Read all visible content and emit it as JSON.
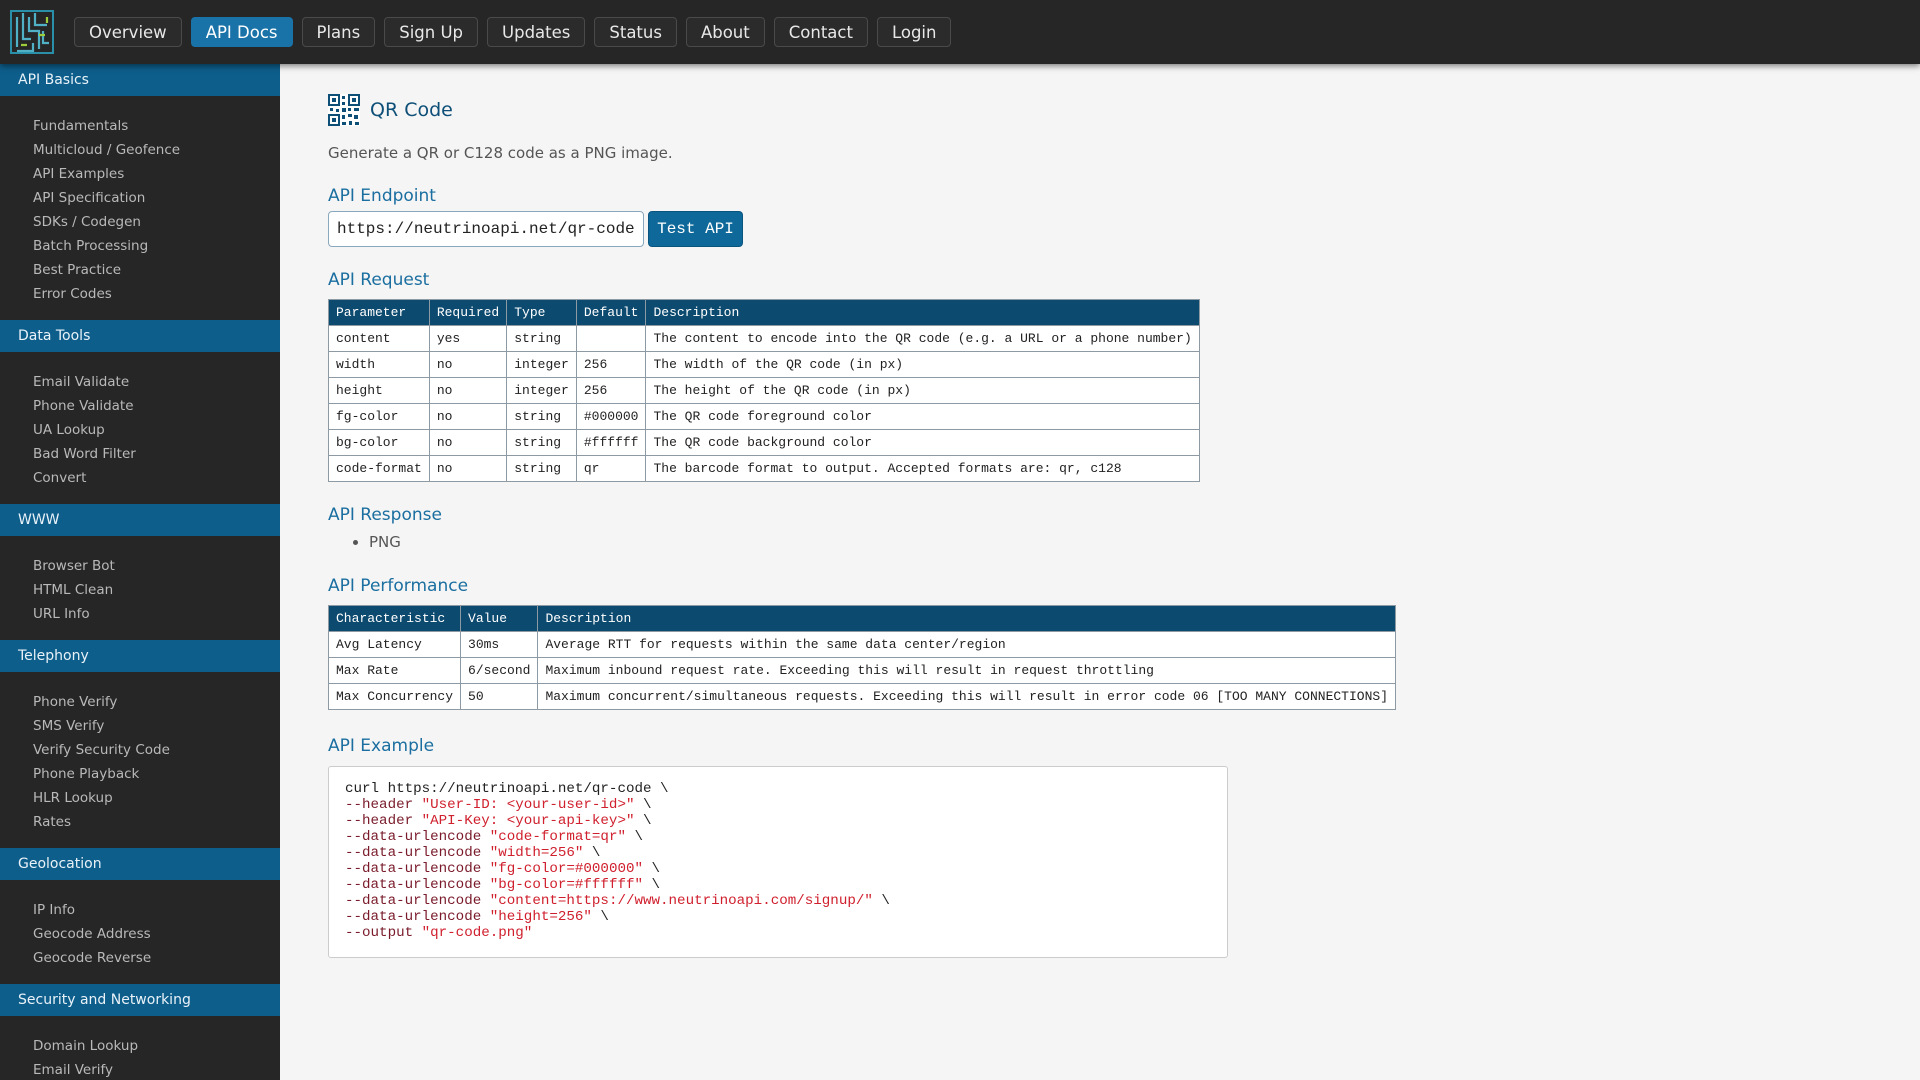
{
  "topnav": {
    "logo": "neutrino-logo-icon",
    "items": [
      {
        "label": "Overview",
        "active": false
      },
      {
        "label": "API Docs",
        "active": true
      },
      {
        "label": "Plans",
        "active": false
      },
      {
        "label": "Sign Up",
        "active": false
      },
      {
        "label": "Updates",
        "active": false
      },
      {
        "label": "Status",
        "active": false
      },
      {
        "label": "About",
        "active": false
      },
      {
        "label": "Contact",
        "active": false
      },
      {
        "label": "Login",
        "active": false
      }
    ]
  },
  "sidebar": {
    "sections": [
      {
        "title": "API Basics",
        "items": [
          "Fundamentals",
          "Multicloud / Geofence",
          "API Examples",
          "API Specification",
          "SDKs / Codegen",
          "Batch Processing",
          "Best Practice",
          "Error Codes"
        ]
      },
      {
        "title": "Data Tools",
        "items": [
          "Email Validate",
          "Phone Validate",
          "UA Lookup",
          "Bad Word Filter",
          "Convert"
        ]
      },
      {
        "title": "WWW",
        "items": [
          "Browser Bot",
          "HTML Clean",
          "URL Info"
        ]
      },
      {
        "title": "Telephony",
        "items": [
          "Phone Verify",
          "SMS Verify",
          "Verify Security Code",
          "Phone Playback",
          "HLR Lookup",
          "Rates"
        ]
      },
      {
        "title": "Geolocation",
        "items": [
          "IP Info",
          "Geocode Address",
          "Geocode Reverse"
        ]
      },
      {
        "title": "Security and Networking",
        "items": [
          "Domain Lookup",
          "Email Verify"
        ]
      }
    ]
  },
  "main": {
    "title": "QR Code",
    "title_icon": "qr-code-icon",
    "description": "Generate a QR or C128 code as a PNG image.",
    "endpoint": {
      "heading": "API Endpoint",
      "url": "https://neutrinoapi.net/qr-code",
      "button": "Test API"
    },
    "request": {
      "heading": "API Request",
      "headers": [
        "Parameter",
        "Required",
        "Type",
        "Default",
        "Description"
      ],
      "rows": [
        [
          "content",
          "yes",
          "string",
          "",
          "The content to encode into the QR code (e.g. a URL or a phone number)"
        ],
        [
          "width",
          "no",
          "integer",
          "256",
          "The width of the QR code (in px)"
        ],
        [
          "height",
          "no",
          "integer",
          "256",
          "The height of the QR code (in px)"
        ],
        [
          "fg-color",
          "no",
          "string",
          "#000000",
          "The QR code foreground color"
        ],
        [
          "bg-color",
          "no",
          "string",
          "#ffffff",
          "The QR code background color"
        ],
        [
          "code-format",
          "no",
          "string",
          "qr",
          "The barcode format to output. Accepted formats are: qr, c128"
        ]
      ]
    },
    "response": {
      "heading": "API Response",
      "items": [
        "PNG"
      ]
    },
    "performance": {
      "heading": "API Performance",
      "headers": [
        "Characteristic",
        "Value",
        "Description"
      ],
      "rows": [
        [
          "Avg Latency",
          "30ms",
          "Average RTT for requests within the same data center/region"
        ],
        [
          "Max Rate",
          "6/second",
          "Maximum inbound request rate. Exceeding this will result in request throttling"
        ],
        [
          "Max Concurrency",
          "50",
          "Maximum concurrent/simultaneous requests. Exceeding this will result in error code 06 [TOO MANY CONNECTIONS]"
        ]
      ]
    },
    "example": {
      "heading": "API Example",
      "lines": [
        {
          "cmd": "curl https://neutrinoapi.net/qr-code \\",
          "opt": "",
          "str": "",
          "tail": ""
        },
        {
          "cmd": "",
          "opt": "--header ",
          "str": "\"User-ID: <your-user-id>\"",
          "tail": " \\"
        },
        {
          "cmd": "",
          "opt": "--header ",
          "str": "\"API-Key: <your-api-key>\"",
          "tail": " \\"
        },
        {
          "cmd": "",
          "opt": "--data-urlencode ",
          "str": "\"code-format=qr\"",
          "tail": " \\"
        },
        {
          "cmd": "",
          "opt": "--data-urlencode ",
          "str": "\"width=256\"",
          "tail": " \\"
        },
        {
          "cmd": "",
          "opt": "--data-urlencode ",
          "str": "\"fg-color=#000000\"",
          "tail": " \\"
        },
        {
          "cmd": "",
          "opt": "--data-urlencode ",
          "str": "\"bg-color=#ffffff\"",
          "tail": " \\"
        },
        {
          "cmd": "",
          "opt": "--data-urlencode ",
          "str": "\"content=https://www.neutrinoapi.com/signup/\"",
          "tail": " \\"
        },
        {
          "cmd": "",
          "opt": "--data-urlencode ",
          "str": "\"height=256\"",
          "tail": " \\"
        },
        {
          "cmd": "",
          "opt": "--output ",
          "str": "\"qr-code.png\"",
          "tail": ""
        }
      ]
    }
  },
  "colors": {
    "topbar": "#262626",
    "accent": "#1a73a8",
    "sidebar_header": "#0e5e8c",
    "table_header": "#0d4a6f",
    "code_string": "#d0202e"
  }
}
